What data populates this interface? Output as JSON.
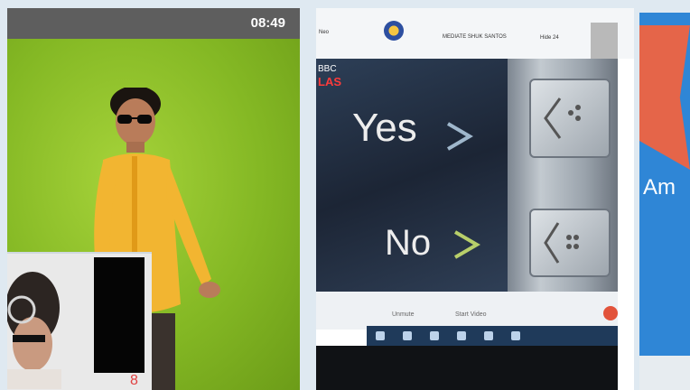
{
  "call_screenshot": {
    "status_bar": {
      "clock": "08:49"
    },
    "thumbnail_mark": "8"
  },
  "laptop_screen": {
    "header": {
      "left_text": "Neo",
      "center_text": "MEDIATE SHUK SANTOS",
      "right_text": "Hide 24"
    },
    "video": {
      "bbc_label": "BBC",
      "las_label": "LAS",
      "yes_label": "Yes",
      "no_label": "No"
    },
    "toolbar": {
      "left_text": "Unmute",
      "center_text": "Start Video"
    }
  },
  "slide": {
    "text": "Am"
  },
  "colors": {
    "greenscreen": "#8fbf2a",
    "status_bar": "#5e5e5e",
    "slide_bg": "#2f86d6",
    "slide_shape": "#e56549"
  }
}
